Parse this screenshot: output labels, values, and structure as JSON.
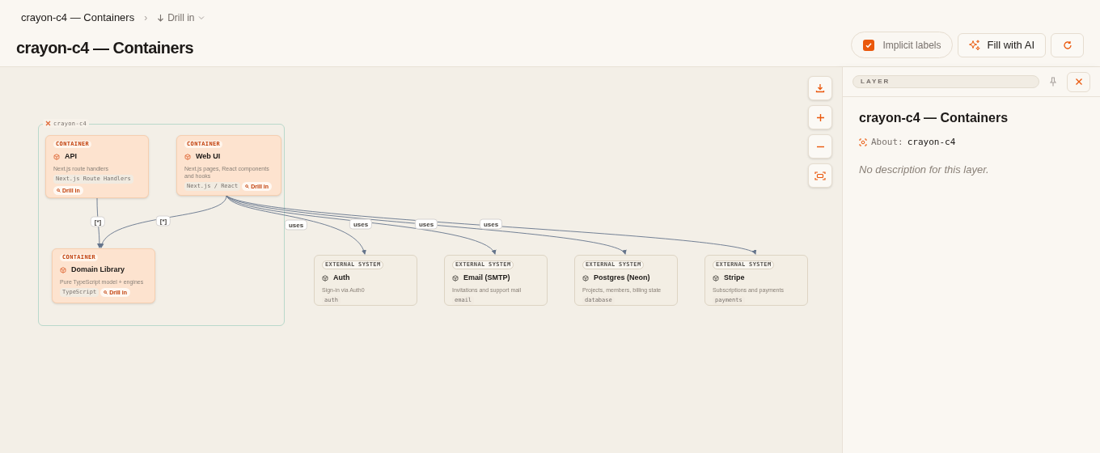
{
  "breadcrumb": {
    "current": "crayon-c4 — Containers",
    "separator": "›",
    "menu": "Drill in"
  },
  "title": "crayon-c4 — Containers",
  "toolbar": {
    "implicit_labels": {
      "label": "Implicit labels",
      "checked": true
    },
    "fill_button": "Fill with AI"
  },
  "diagram": {
    "boundary": "crayon-c4",
    "nodes": [
      {
        "kind": "container",
        "tag": "CONTAINER",
        "name": "API",
        "description": "Next.js route handlers",
        "tech": "Next.js Route Handlers",
        "drill": "Drill in"
      },
      {
        "kind": "container",
        "tag": "CONTAINER",
        "name": "Web UI",
        "description": "Next.js pages, React components and hooks",
        "tech": "Next.js / React",
        "drill": "Drill in"
      },
      {
        "kind": "container",
        "tag": "CONTAINER",
        "name": "Domain Library",
        "description": "Pure TypeScript model + engines",
        "tech": "TypeScript",
        "drill": "Drill in"
      },
      {
        "kind": "external",
        "tag": "EXTERNAL SYSTEM",
        "name": "Auth",
        "description": "Sign-in via Auth0",
        "tech": "auth"
      },
      {
        "kind": "external",
        "tag": "EXTERNAL SYSTEM",
        "name": "Email (SMTP)",
        "description": "Invitations and support mail",
        "tech": "email"
      },
      {
        "kind": "external",
        "tag": "EXTERNAL SYSTEM",
        "name": "Postgres (Neon)",
        "description": "Projects, members, billing state",
        "tech": "database"
      },
      {
        "kind": "external",
        "tag": "EXTERNAL SYSTEM",
        "name": "Stripe",
        "description": "Subscriptions and payments",
        "tech": "payments"
      }
    ],
    "edges": [
      {
        "label": "[*]"
      },
      {
        "label": "[*]"
      },
      {
        "label": "uses"
      },
      {
        "label": "uses"
      },
      {
        "label": "uses"
      },
      {
        "label": "uses"
      }
    ]
  },
  "panel": {
    "badge": "LAYER",
    "title": "crayon-c4 — Containers",
    "about_label": "About:",
    "about_value": "crayon-c4",
    "description": "No description for this layer."
  }
}
